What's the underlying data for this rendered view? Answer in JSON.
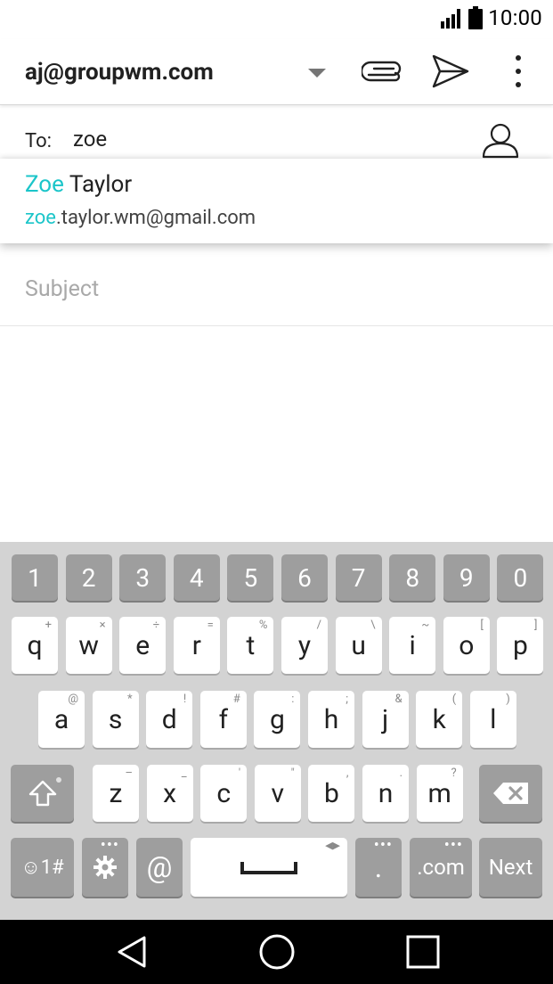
{
  "status": {
    "time": "10:00"
  },
  "compose": {
    "from": "aj@groupwm.com",
    "to_label": "To:",
    "to_value": "zoe",
    "subject_placeholder": "Subject"
  },
  "suggestion": {
    "name_match": "Zoe",
    "name_rest": " Taylor",
    "email_match": "zoe",
    "email_rest": ".taylor.wm@gmail.com"
  },
  "keyboard": {
    "number_row": [
      "1",
      "2",
      "3",
      "4",
      "5",
      "6",
      "7",
      "8",
      "9",
      "0"
    ],
    "row1": [
      {
        "k": "q",
        "s": "+"
      },
      {
        "k": "w",
        "s": "×"
      },
      {
        "k": "e",
        "s": "÷"
      },
      {
        "k": "r",
        "s": "="
      },
      {
        "k": "t",
        "s": "%"
      },
      {
        "k": "y",
        "s": "/"
      },
      {
        "k": "u",
        "s": "\\"
      },
      {
        "k": "i",
        "s": "~"
      },
      {
        "k": "o",
        "s": "["
      },
      {
        "k": "p",
        "s": "]"
      }
    ],
    "row2": [
      {
        "k": "a",
        "s": "@"
      },
      {
        "k": "s",
        "s": "*"
      },
      {
        "k": "d",
        "s": "!"
      },
      {
        "k": "f",
        "s": "#"
      },
      {
        "k": "g",
        "s": ":"
      },
      {
        "k": "h",
        "s": ";"
      },
      {
        "k": "j",
        "s": "&"
      },
      {
        "k": "k",
        "s": "("
      },
      {
        "k": "l",
        "s": ")"
      }
    ],
    "row3": [
      {
        "k": "z",
        "s": "–"
      },
      {
        "k": "x",
        "s": "_"
      },
      {
        "k": "c",
        "s": "'"
      },
      {
        "k": "v",
        "s": "\""
      },
      {
        "k": "b",
        "s": ","
      },
      {
        "k": "n",
        "s": "."
      },
      {
        "k": "m",
        "s": "?"
      }
    ],
    "symbols_label": "☺1#",
    "at_label": "@",
    "period_label": ".",
    "dotcom_label": ".com",
    "next_label": "Next"
  },
  "icons": {
    "attach": "paperclip-icon",
    "send": "send-icon",
    "more": "more-vert-icon",
    "contact": "person-icon",
    "shift": "shift-icon",
    "backspace": "backspace-icon",
    "settings": "gear-icon",
    "space": "space-icon",
    "nav_back": "back-icon",
    "nav_home": "home-icon",
    "nav_recents": "recents-icon"
  },
  "colors": {
    "highlight": "#1bc5c9",
    "keyboard_bg": "#d3d3d3",
    "key_dark": "#9e9e9e"
  }
}
